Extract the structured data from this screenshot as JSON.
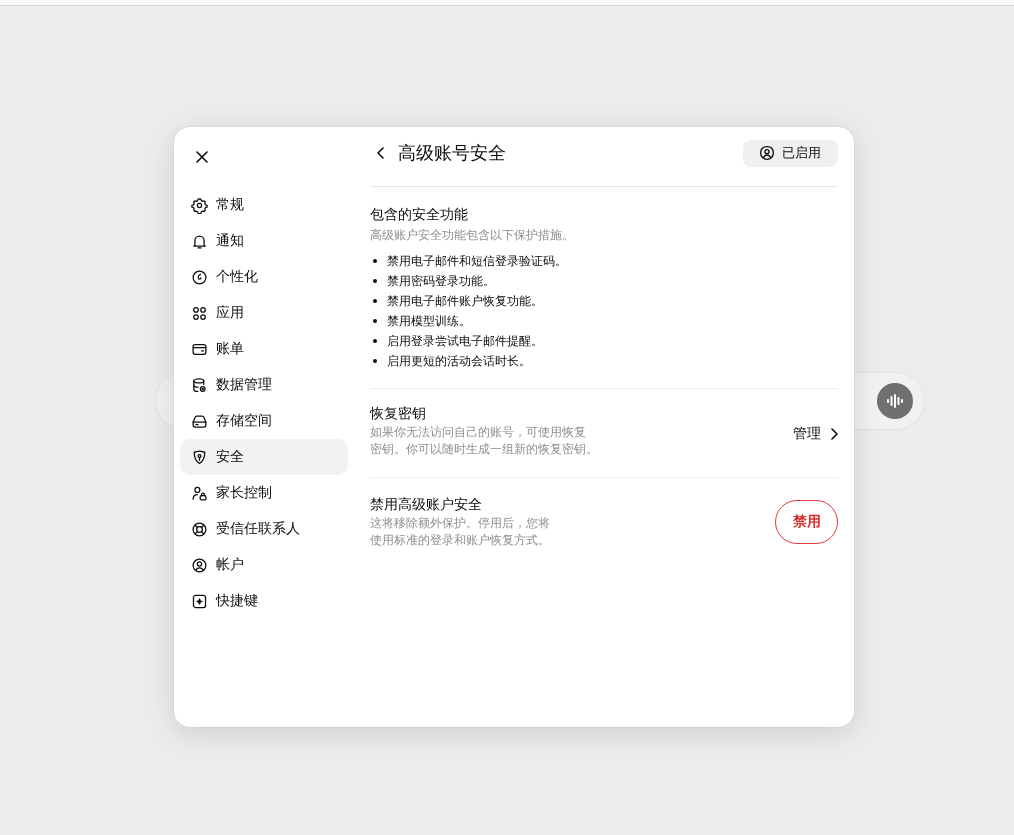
{
  "sidebar": {
    "items": [
      {
        "label": "常规",
        "selected": false
      },
      {
        "label": "通知",
        "selected": false
      },
      {
        "label": "个性化",
        "selected": false
      },
      {
        "label": "应用",
        "selected": false
      },
      {
        "label": "账单",
        "selected": false
      },
      {
        "label": "数据管理",
        "selected": false
      },
      {
        "label": "存储空间",
        "selected": false
      },
      {
        "label": "安全",
        "selected": true
      },
      {
        "label": "家长控制",
        "selected": false
      },
      {
        "label": "受信任联系人",
        "selected": false
      },
      {
        "label": "帐户",
        "selected": false
      },
      {
        "label": "快捷键",
        "selected": false
      }
    ]
  },
  "header": {
    "title": "高级账号安全",
    "status": "已启用"
  },
  "features": {
    "title": "包含的安全功能",
    "subtitle": "高级账户安全功能包含以下保护措施。",
    "items": [
      "禁用电子邮件和短信登录验证码。",
      "禁用密码登录功能。",
      "禁用电子邮件账户恢复功能。",
      "禁用模型训练。",
      "启用登录尝试电子邮件提醒。",
      "启用更短的活动会话时长。"
    ]
  },
  "recovery_key": {
    "title": "恢复密钥",
    "description": "如果你无法访问自己的账号，可使用恢复密钥。你可以随时生成一组新的恢复密钥。",
    "action": "管理"
  },
  "disable": {
    "title": "禁用高级账户安全",
    "description": "这将移除额外保护。停用后，您将使用标准的登录和账户恢复方式。",
    "button": "禁用"
  }
}
